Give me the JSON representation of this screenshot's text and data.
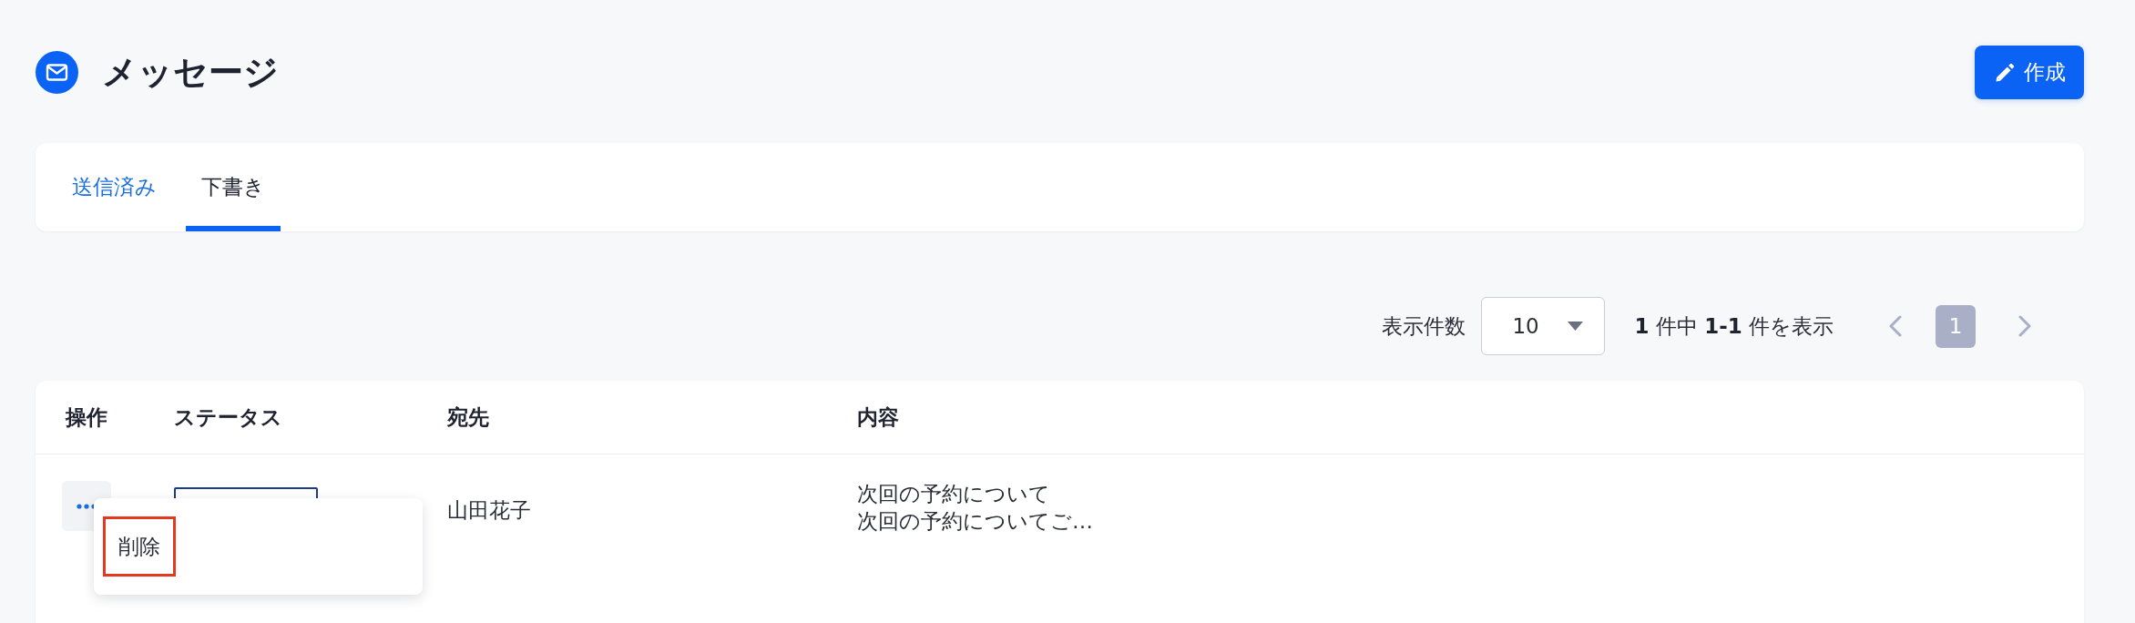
{
  "header": {
    "title": "メッセージ",
    "create_button": "作成"
  },
  "tabs": [
    {
      "label": "送信済み",
      "selected": false
    },
    {
      "label": "下書き",
      "selected": true
    }
  ],
  "pagination": {
    "page_size_label": "表示件数",
    "page_size": "10",
    "summary": "**1** 件中 **1-1** 件を表示",
    "prev": {
      "disabled": true
    },
    "pages": [
      {
        "label": "1",
        "selected": true
      }
    ],
    "next": {
      "disabled": true
    }
  },
  "table": {
    "columns": [
      "操作",
      "ステータス",
      "宛先",
      "内容"
    ],
    "rows": [
      {
        "recipient": "山田花子",
        "subject": "次回の予約について",
        "preview": "次回の予約についてご…",
        "menu": {
          "open": true,
          "items": [
            {
              "label": "削除",
              "highlighted": true
            }
          ]
        }
      }
    ]
  }
}
